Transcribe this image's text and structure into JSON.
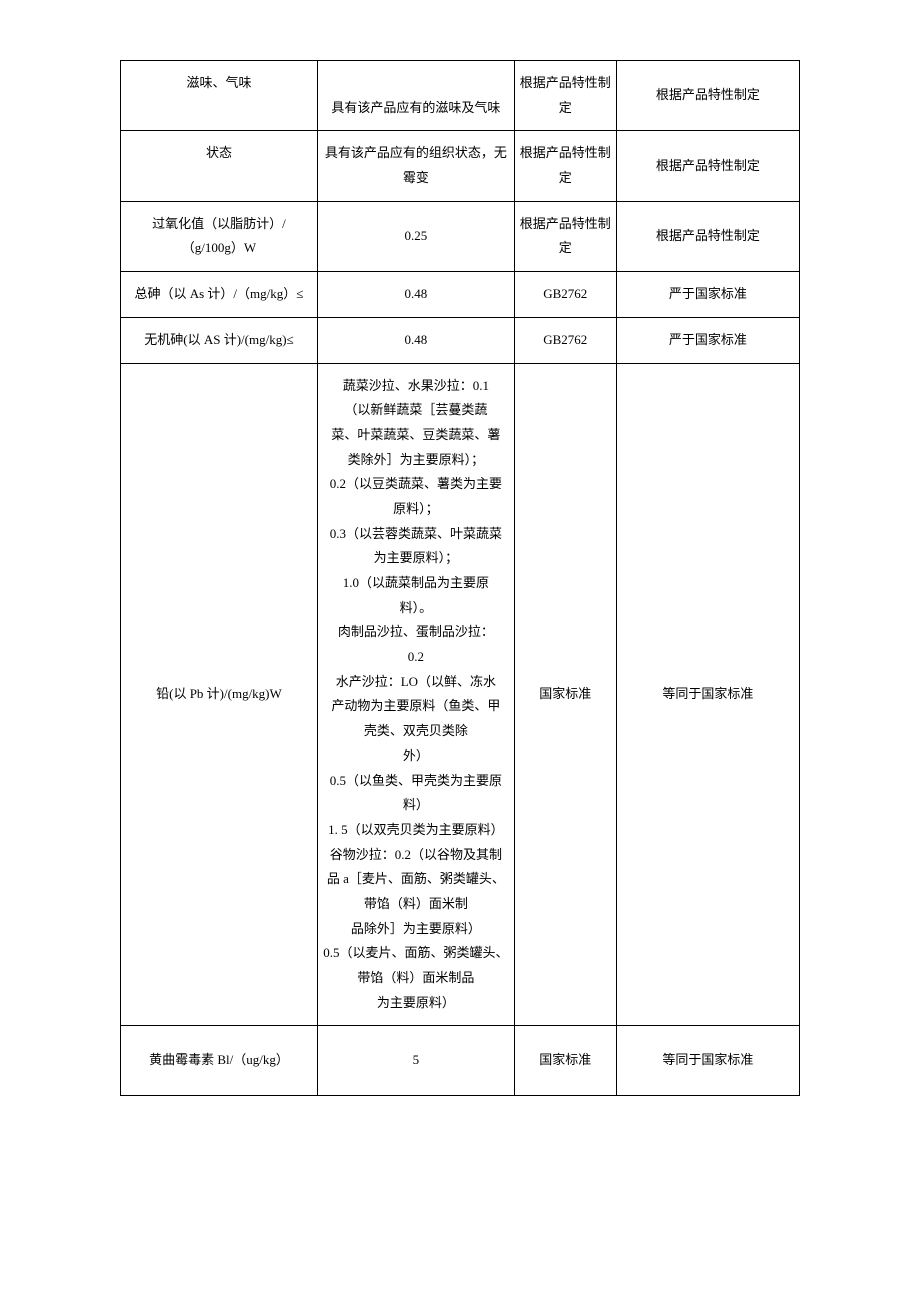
{
  "rows": [
    {
      "name": "滋味、气味",
      "value": "具有该产品应有的滋味及气味",
      "basis": "根据产品特性制定",
      "remark": "根据产品特性制定"
    },
    {
      "name": "状态",
      "value": "具有该产品应有的组织状态，无霉变",
      "basis": "根据产品特性制定",
      "remark": "根据产品特性制定"
    },
    {
      "name": "过氧化值（以脂肪计）/（g/100g）W",
      "value": "0.25",
      "basis": "根据产品特性制定",
      "remark": "根据产品特性制定"
    },
    {
      "name": "总砷（以 As 计）/（mg/kg）≤",
      "value": "0.48",
      "basis": "GB2762",
      "remark": "严于国家标准"
    },
    {
      "name": "无机砷(以 AS 计)/(mg/kg)≤",
      "value": "0.48",
      "basis": "GB2762",
      "remark": "严于国家标准"
    },
    {
      "name": "铅(以 Pb 计)/(mg/kg)W",
      "basis": "国家标准",
      "remark": "等同于国家标准",
      "lines": [
        "蔬菜沙拉、水果沙拉：0.1",
        "（以新鲜蔬菜［芸蔓类蔬",
        "菜、叶菜蔬菜、豆类蔬菜、薯",
        "类除外］为主要原料）；",
        "0.2（以豆类蔬菜、薯类为主要",
        "原料）；",
        "0.3（以芸蓉类蔬菜、叶菜蔬菜",
        "为主要原料）；",
        "1.0（以蔬菜制品为主要原",
        "料）。",
        "肉制品沙拉、蛋制品沙拉：",
        "0.2",
        "水产沙拉：LO（以鲜、冻水",
        "产动物为主要原料（鱼类、甲",
        "壳类、双壳贝类除",
        "外）",
        "0.5（以鱼类、甲壳类为主要原",
        "料）",
        "1. 5（以双壳贝类为主要原料）",
        "谷物沙拉：0.2（以谷物及其制",
        "品 a［麦片、面筋、粥类罐头、",
        "带馅（料）面米制",
        "品除外］为主要原料）",
        "0.5（以麦片、面筋、粥类罐头、",
        "带馅（料）面米制品",
        "为主要原料）"
      ]
    },
    {
      "name": "黄曲霉毒素 Bl/（ug/kg）",
      "value": "5",
      "basis": "国家标准",
      "remark": "等同于国家标准"
    }
  ]
}
